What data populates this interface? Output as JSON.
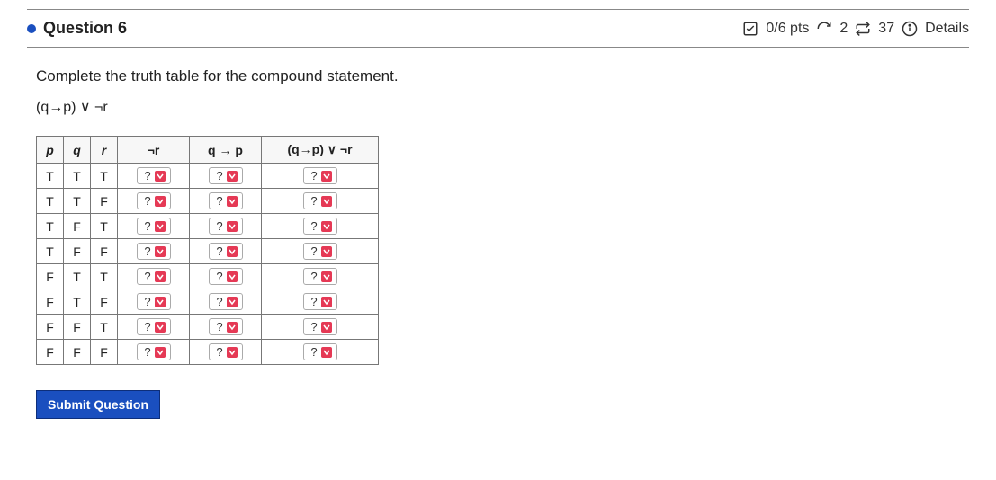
{
  "header": {
    "title": "Question 6",
    "score": "0/6 pts",
    "attempts": "2",
    "tries": "37",
    "details": "Details"
  },
  "prompt": "Complete the truth table for the compound statement.",
  "expression": "(q→p) ∨ ¬r",
  "table": {
    "headers": [
      "p",
      "q",
      "r",
      "¬r",
      "q → p",
      "(q→p) ∨ ¬r"
    ],
    "rows": [
      {
        "p": "T",
        "q": "T",
        "r": "T",
        "nr": "?",
        "qp": "?",
        "res": "?"
      },
      {
        "p": "T",
        "q": "T",
        "r": "F",
        "nr": "?",
        "qp": "?",
        "res": "?"
      },
      {
        "p": "T",
        "q": "F",
        "r": "T",
        "nr": "?",
        "qp": "?",
        "res": "?"
      },
      {
        "p": "T",
        "q": "F",
        "r": "F",
        "nr": "?",
        "qp": "?",
        "res": "?"
      },
      {
        "p": "F",
        "q": "T",
        "r": "T",
        "nr": "?",
        "qp": "?",
        "res": "?"
      },
      {
        "p": "F",
        "q": "T",
        "r": "F",
        "nr": "?",
        "qp": "?",
        "res": "?"
      },
      {
        "p": "F",
        "q": "F",
        "r": "T",
        "nr": "?",
        "qp": "?",
        "res": "?"
      },
      {
        "p": "F",
        "q": "F",
        "r": "F",
        "nr": "?",
        "qp": "?",
        "res": "?"
      }
    ]
  },
  "submit_label": "Submit Question"
}
